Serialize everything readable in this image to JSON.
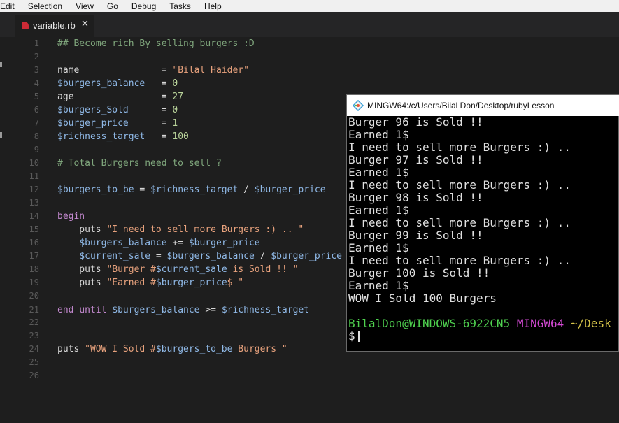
{
  "menubar": [
    "Edit",
    "Selection",
    "View",
    "Go",
    "Debug",
    "Tasks",
    "Help"
  ],
  "editor": {
    "tab_name": "variable.rb",
    "tab_close": "✕",
    "lines": [
      {
        "n": "1",
        "parts": [
          [
            "com",
            "## Become rich By selling burgers :D"
          ]
        ]
      },
      {
        "n": "2",
        "parts": []
      },
      {
        "n": "3",
        "parts": [
          [
            "txt",
            "name               = "
          ],
          [
            "str",
            "\"Bilal Haider\""
          ]
        ]
      },
      {
        "n": "4",
        "parts": [
          [
            "gv",
            "$burgers_balance"
          ],
          [
            "txt",
            "   = "
          ],
          [
            "num",
            "0"
          ]
        ]
      },
      {
        "n": "5",
        "parts": [
          [
            "txt",
            "age                = "
          ],
          [
            "num",
            "27"
          ]
        ]
      },
      {
        "n": "6",
        "parts": [
          [
            "gv",
            "$burgers_Sold"
          ],
          [
            "txt",
            "      = "
          ],
          [
            "num",
            "0"
          ]
        ]
      },
      {
        "n": "7",
        "parts": [
          [
            "gv",
            "$burger_price"
          ],
          [
            "txt",
            "      = "
          ],
          [
            "num",
            "1"
          ]
        ]
      },
      {
        "n": "8",
        "parts": [
          [
            "gv",
            "$richness_target"
          ],
          [
            "txt",
            "   = "
          ],
          [
            "num",
            "100"
          ]
        ]
      },
      {
        "n": "9",
        "parts": []
      },
      {
        "n": "10",
        "parts": [
          [
            "com",
            "# Total Burgers need to sell ?"
          ]
        ]
      },
      {
        "n": "11",
        "parts": []
      },
      {
        "n": "12",
        "parts": [
          [
            "gv",
            "$burgers_to_be"
          ],
          [
            "txt",
            " = "
          ],
          [
            "gv",
            "$richness_target"
          ],
          [
            "txt",
            " / "
          ],
          [
            "gv",
            "$burger_price"
          ]
        ]
      },
      {
        "n": "13",
        "parts": []
      },
      {
        "n": "14",
        "parts": [
          [
            "kw",
            "begin"
          ]
        ]
      },
      {
        "n": "15",
        "parts": [
          [
            "txt",
            "    puts "
          ],
          [
            "str",
            "\"I need to sell more Burgers :) .. \""
          ]
        ]
      },
      {
        "n": "16",
        "parts": [
          [
            "txt",
            "    "
          ],
          [
            "gv",
            "$burgers_balance"
          ],
          [
            "txt",
            " += "
          ],
          [
            "gv",
            "$burger_price"
          ]
        ]
      },
      {
        "n": "17",
        "parts": [
          [
            "txt",
            "    "
          ],
          [
            "gv",
            "$current_sale"
          ],
          [
            "txt",
            " = "
          ],
          [
            "gv",
            "$burgers_balance"
          ],
          [
            "txt",
            " / "
          ],
          [
            "gv",
            "$burger_price"
          ]
        ]
      },
      {
        "n": "18",
        "parts": [
          [
            "txt",
            "    puts "
          ],
          [
            "str",
            "\"Burger #"
          ],
          [
            "gv",
            "$current_sale"
          ],
          [
            "str",
            " is Sold !! \""
          ]
        ]
      },
      {
        "n": "19",
        "parts": [
          [
            "txt",
            "    puts "
          ],
          [
            "str",
            "\"Earned #"
          ],
          [
            "gv",
            "$burger_price"
          ],
          [
            "str",
            "$ \""
          ]
        ]
      },
      {
        "n": "20",
        "parts": []
      },
      {
        "n": "21",
        "parts": [
          [
            "kw",
            "end until"
          ],
          [
            "txt",
            " "
          ],
          [
            "gv",
            "$burgers_balance"
          ],
          [
            "txt",
            " >= "
          ],
          [
            "gv",
            "$richness_target"
          ]
        ]
      },
      {
        "n": "22",
        "parts": []
      },
      {
        "n": "23",
        "parts": []
      },
      {
        "n": "24",
        "parts": [
          [
            "txt",
            "puts "
          ],
          [
            "str",
            "\"WOW I Sold #"
          ],
          [
            "gv",
            "$burgers_to_be"
          ],
          [
            "str",
            " Burgers \""
          ]
        ]
      },
      {
        "n": "25",
        "parts": []
      },
      {
        "n": "26",
        "parts": []
      }
    ]
  },
  "terminal": {
    "title": "MINGW64:/c/Users/Bilal Don/Desktop/rubyLesson",
    "output": [
      "Burger 96 is Sold !!",
      "Earned 1$",
      "I need to sell more Burgers :) ..",
      "Burger 97 is Sold !!",
      "Earned 1$",
      "I need to sell more Burgers :) ..",
      "Burger 98 is Sold !!",
      "Earned 1$",
      "I need to sell more Burgers :) ..",
      "Burger 99 is Sold !!",
      "Earned 1$",
      "I need to sell more Burgers :) ..",
      "Burger 100 is Sold !!",
      "Earned 1$",
      "WOW I Sold 100 Burgers"
    ],
    "prompt_user": "BilalDon@WINDOWS-6922CN5",
    "prompt_system": "MINGW64",
    "prompt_path": "~/Desk",
    "prompt_symbol": "$"
  }
}
